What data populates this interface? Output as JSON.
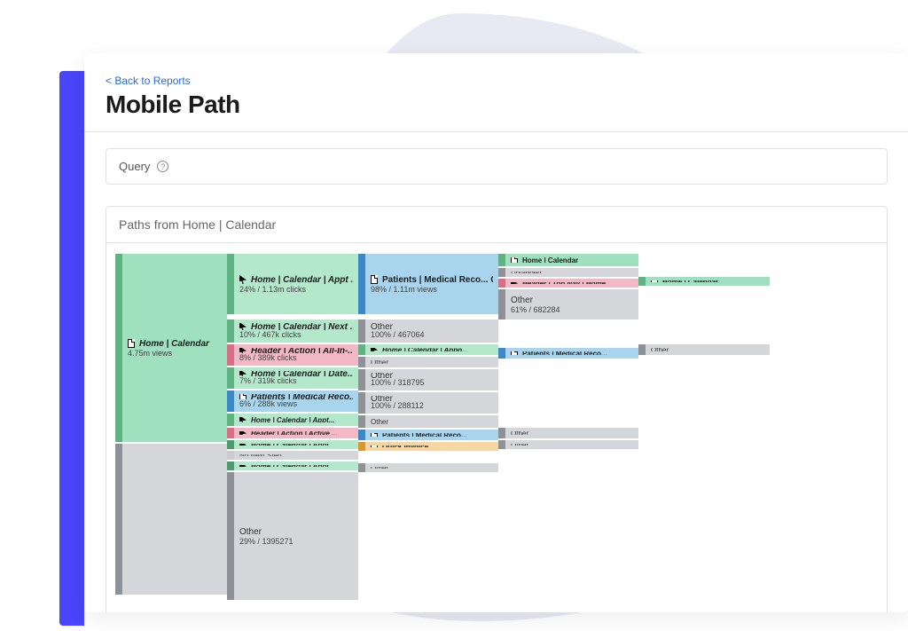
{
  "back_link": "< Back to Reports",
  "title": "Mobile Path",
  "query_label": "Query",
  "paths_label": "Paths from Home | Calendar",
  "col0": {
    "n0": {
      "title": "Home | Calendar",
      "sub": "4.75m views"
    }
  },
  "col1": {
    "n0": {
      "title": "Home | Calendar | Appt ...",
      "sub": "24% / 1.13m clicks"
    },
    "n1": {
      "title": "Home | Calendar | Next ...",
      "sub": "10% / 467k clicks"
    },
    "n2": {
      "title": "Header | Action | All-In-...",
      "sub": "8% / 389k clicks"
    },
    "n3": {
      "title": "Home | Calendar | Date...",
      "sub": "7% / 319k clicks"
    },
    "n4": {
      "title": "Patients | Medical Reco...",
      "sub": "6% / 288k views"
    },
    "n5": {
      "title": "Home | Calendar | Appt...",
      "sub": ""
    },
    "n6": {
      "title": "Header | Action | Active ...",
      "sub": ""
    },
    "n7": {
      "title": "Home | Calendar | Appt ...",
      "sub": ""
    },
    "n8": {
      "title": "No Next Step",
      "sub": ""
    },
    "n9": {
      "title": "Home | Calendar | Appt...",
      "sub": ""
    },
    "other": {
      "title": "Other",
      "sub": "29% / 1395271"
    }
  },
  "col2": {
    "n0": {
      "title": "Patients | Medical Reco... Care Plan",
      "sub": "98% / 1.11m views"
    },
    "n1": {
      "title": "Other",
      "sub": "100% / 467064"
    },
    "n2a": {
      "title": "Home | Calendar | Appo...",
      "sub": ""
    },
    "n2b": {
      "title": "Other",
      "sub": ""
    },
    "n3": {
      "title": "Other",
      "sub": "100% / 318795"
    },
    "n4": {
      "title": "Other",
      "sub": "100% / 288112"
    },
    "n5": {
      "title": "Other",
      "sub": ""
    },
    "n6a": {
      "title": "Patients | Medical Reco...",
      "sub": ""
    },
    "n6b": {
      "title": "Quick Invoice",
      "sub": ""
    },
    "n7": {
      "title": "Other",
      "sub": ""
    }
  },
  "col3": {
    "n0a": {
      "title": "Home | Calendar",
      "sub": ""
    },
    "n0b": {
      "title": "Untagged",
      "sub": ""
    },
    "n0c": {
      "title": "Header | Top Nav | Home",
      "sub": ""
    },
    "n0d": {
      "title": "Other",
      "sub": "61% / 682284"
    },
    "n2a": {
      "title": "Patients | Medical Reco...",
      "sub": ""
    },
    "n6a": {
      "title": "Other",
      "sub": ""
    },
    "n6b": {
      "title": "Other",
      "sub": ""
    }
  },
  "col4": {
    "n0": {
      "title": "Home | Calendar",
      "sub": ""
    },
    "n2a": {
      "title": "Other",
      "sub": ""
    }
  }
}
